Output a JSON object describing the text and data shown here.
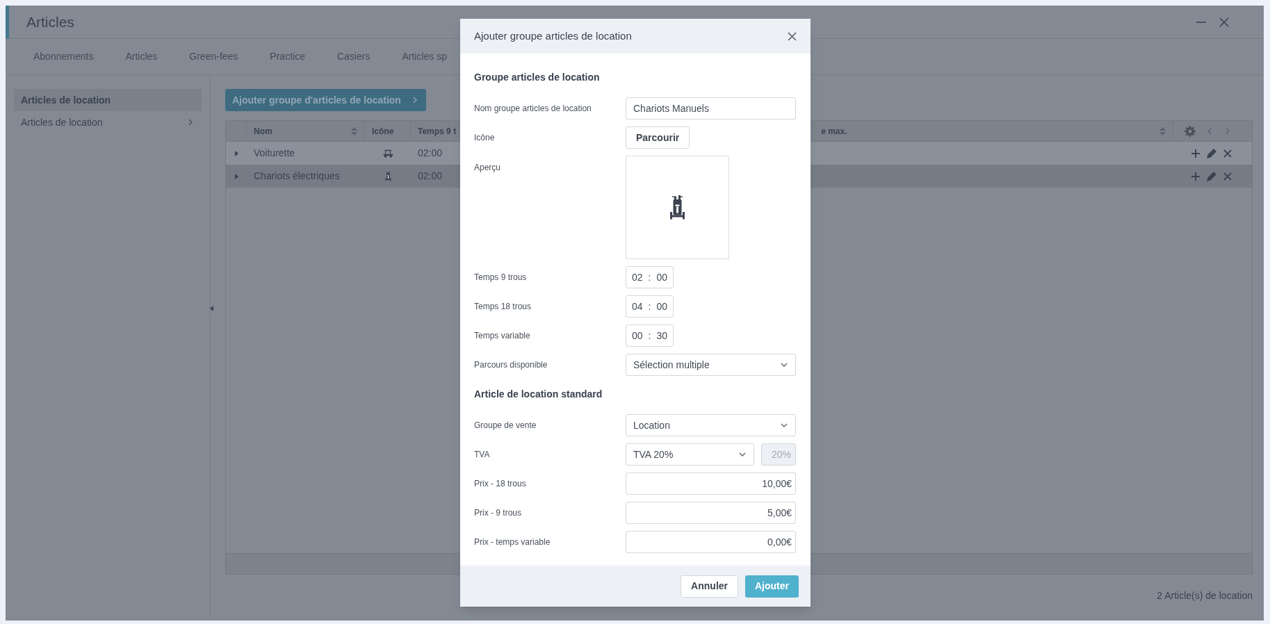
{
  "window": {
    "title": "Articles"
  },
  "tabs": [
    {
      "label": "Abonnements"
    },
    {
      "label": "Articles"
    },
    {
      "label": "Green-fees"
    },
    {
      "label": "Practice"
    },
    {
      "label": "Casiers"
    },
    {
      "label": "Articles sp"
    }
  ],
  "sidebar": {
    "items": [
      {
        "label": "Articles de location",
        "selected": true,
        "expandable": false
      },
      {
        "label": "Articles de location",
        "selected": false,
        "expandable": true
      }
    ]
  },
  "add_button": {
    "label": "Ajouter groupe d'articles de location"
  },
  "table": {
    "columns": [
      {
        "label": "Nom",
        "sortable": true
      },
      {
        "label": "Icône",
        "sortable": false
      },
      {
        "label": "Temps 9 t",
        "sortable": false
      },
      {
        "label": "e max.",
        "sortable": true
      }
    ],
    "rows": [
      {
        "name": "Voiturette",
        "kind": "cart",
        "time": "02:00",
        "highlighted": false
      },
      {
        "name": "Chariots électriques",
        "kind": "trolley",
        "time": "02:00",
        "highlighted": true
      }
    ]
  },
  "footer": {
    "count": "2 Article(s) de location"
  },
  "dialog": {
    "title": "Ajouter groupe articles de location",
    "sections": [
      {
        "title": "Groupe articles de location",
        "fields": [
          {
            "kind": "text",
            "label": "Nom groupe articles de location",
            "value": "Chariots Manuels"
          },
          {
            "kind": "browse",
            "label": "Icône",
            "button": "Parcourir"
          },
          {
            "kind": "preview",
            "label": "Aperçu"
          },
          {
            "kind": "time",
            "label": "Temps 9 trous",
            "hours": "02",
            "separator": ":",
            "minutes": "00"
          },
          {
            "kind": "time",
            "label": "Temps 18 trous",
            "hours": "04",
            "separator": ":",
            "minutes": "00"
          },
          {
            "kind": "time",
            "label": "Temps variable",
            "hours": "00",
            "separator": ":",
            "minutes": "30"
          },
          {
            "kind": "select",
            "label": "Parcours disponible",
            "value": "Sélection multiple"
          }
        ]
      },
      {
        "title": "Article de location standard",
        "fields": [
          {
            "kind": "select",
            "label": "Groupe de vente",
            "value": "Location"
          },
          {
            "kind": "select_rate",
            "label": "TVA",
            "value": "TVA 20%",
            "rate": "20%"
          },
          {
            "kind": "money",
            "label": "Prix - 18 trous",
            "value": "10,00€"
          },
          {
            "kind": "money",
            "label": "Prix - 9 trous",
            "value": "5,00€"
          },
          {
            "kind": "money",
            "label": "Prix - temps variable",
            "value": "0,00€"
          }
        ]
      }
    ],
    "buttons": [
      {
        "label": "Annuler",
        "primary": false
      },
      {
        "label": "Ajouter",
        "primary": true
      }
    ]
  }
}
